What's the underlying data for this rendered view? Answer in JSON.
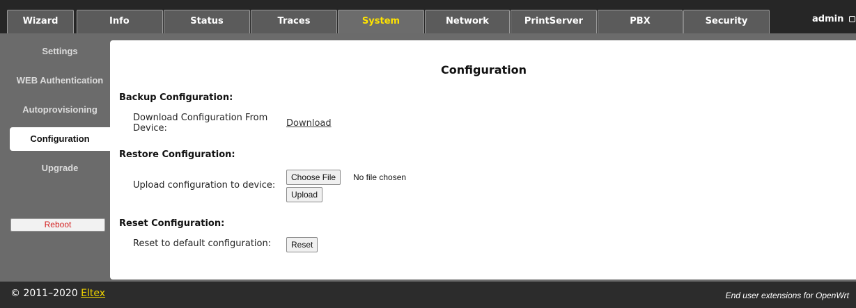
{
  "nav": {
    "tabs": [
      {
        "label": "Wizard"
      },
      {
        "label": "Info"
      },
      {
        "label": "Status"
      },
      {
        "label": "Traces"
      },
      {
        "label": "System",
        "active": true
      },
      {
        "label": "Network"
      },
      {
        "label": "PrintServer"
      },
      {
        "label": "PBX"
      },
      {
        "label": "Security"
      }
    ],
    "user": "admin"
  },
  "sidebar": {
    "items": [
      {
        "label": "Settings"
      },
      {
        "label": "WEB Authentication"
      },
      {
        "label": "Autoprovisioning"
      },
      {
        "label": "Configuration",
        "active": true
      },
      {
        "label": "Upgrade"
      }
    ],
    "reboot_label": "Reboot"
  },
  "main": {
    "title": "Configuration",
    "backup": {
      "heading": "Backup Configuration:",
      "label_line1": "Download Configuration From",
      "label_line2": "Device:",
      "link": "Download"
    },
    "restore": {
      "heading": "Restore Configuration:",
      "label": "Upload configuration to device:",
      "choose_file_label": "Choose File",
      "file_status": "No file chosen",
      "upload_label": "Upload"
    },
    "reset": {
      "heading": "Reset Configuration:",
      "label": "Reset to default configuration:",
      "button_label": "Reset"
    }
  },
  "footer": {
    "copyright": "© 2011–2020",
    "brand_link": "Eltex",
    "tagline": "End user extensions for OpenWrt"
  },
  "colors": {
    "accent_active_tab": "#ffe300",
    "reboot_text": "#d42020",
    "brand_link": "#f2d500"
  },
  "icons": {
    "user_menu": "logout-icon"
  }
}
